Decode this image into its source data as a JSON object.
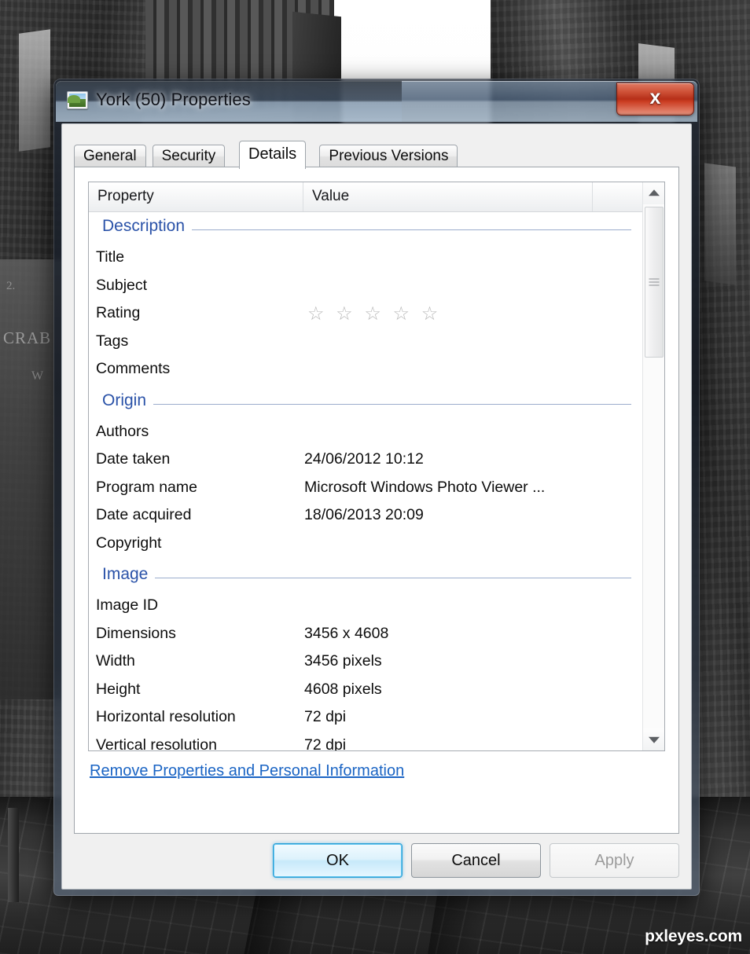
{
  "background": {
    "watermark": "pxleyes.com"
  },
  "window": {
    "title": "York (50) Properties",
    "icon": "photo-thumbnail-icon",
    "close_label": "x"
  },
  "tabs": [
    {
      "label": "General",
      "active": false
    },
    {
      "label": "Security",
      "active": false
    },
    {
      "label": "Details",
      "active": true
    },
    {
      "label": "Previous Versions",
      "active": false
    }
  ],
  "list_header": {
    "property": "Property",
    "value": "Value"
  },
  "sections": [
    {
      "title": "Description",
      "rows": [
        {
          "name": "Title",
          "value": ""
        },
        {
          "name": "Subject",
          "value": ""
        },
        {
          "name": "Rating",
          "value": "",
          "stars": "☆ ☆ ☆ ☆ ☆",
          "rating": 0
        },
        {
          "name": "Tags",
          "value": ""
        },
        {
          "name": "Comments",
          "value": ""
        }
      ]
    },
    {
      "title": "Origin",
      "rows": [
        {
          "name": "Authors",
          "value": ""
        },
        {
          "name": "Date taken",
          "value": "24/06/2012 10:12"
        },
        {
          "name": "Program name",
          "value": "Microsoft Windows Photo Viewer ..."
        },
        {
          "name": "Date acquired",
          "value": "18/06/2013 20:09"
        },
        {
          "name": "Copyright",
          "value": ""
        }
      ]
    },
    {
      "title": "Image",
      "rows": [
        {
          "name": "Image ID",
          "value": ""
        },
        {
          "name": "Dimensions",
          "value": "3456 x 4608"
        },
        {
          "name": "Width",
          "value": "3456 pixels"
        },
        {
          "name": "Height",
          "value": "4608 pixels"
        },
        {
          "name": "Horizontal resolution",
          "value": "72 dpi"
        },
        {
          "name": "Vertical resolution",
          "value": "72 dpi"
        }
      ]
    }
  ],
  "remove_link": "Remove Properties and Personal Information",
  "buttons": {
    "ok": "OK",
    "cancel": "Cancel",
    "apply": "Apply"
  },
  "colors": {
    "accent_blue": "#2a52a8",
    "link_blue": "#1a64c4",
    "close_red": "#b62f18",
    "focus_blue": "#2a9fd6"
  }
}
